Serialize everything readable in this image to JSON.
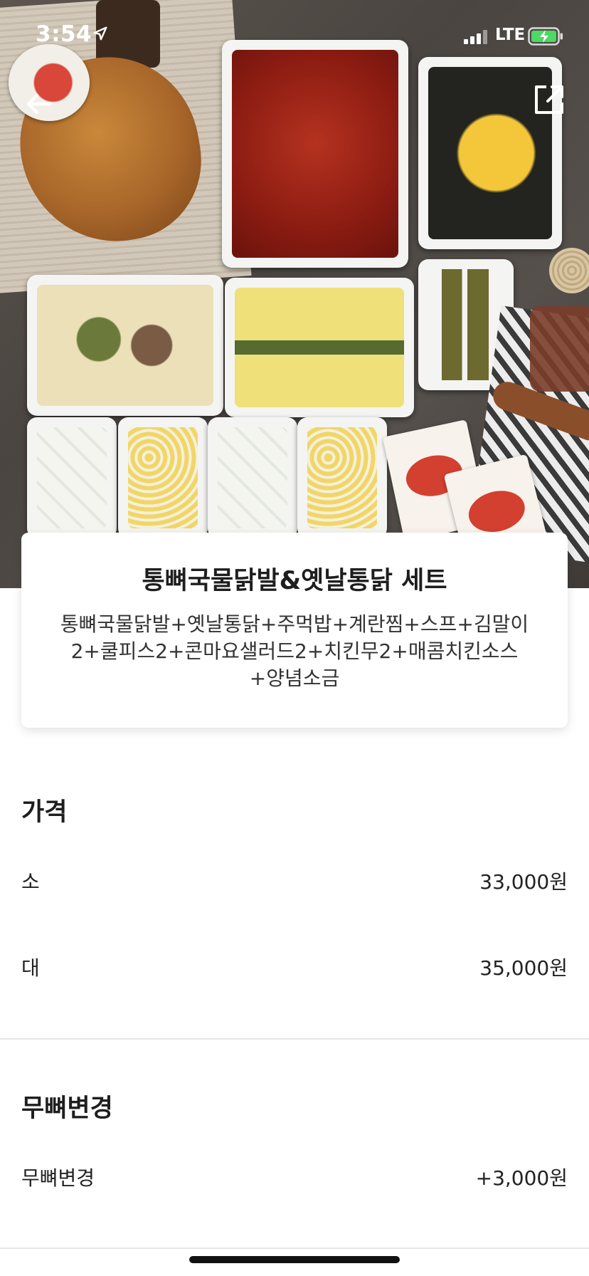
{
  "status_bar": {
    "time": "3:54",
    "network": "LTE",
    "icons": [
      "location-arrow-icon",
      "signal-icon",
      "battery-charging-icon"
    ]
  },
  "nav": {
    "back_icon": "arrow-left-icon",
    "share_icon": "external-share-icon"
  },
  "menu": {
    "title": "통뼈국물닭발&옛날통닭 세트",
    "description_lines": [
      "통뼈국물닭발+옛날통닭+주먹밥+계란찜+스프+김말이",
      "2+쿨피스2+콘마요샐러드2+치킨무2+매콤치킨소스",
      "+양념소금"
    ]
  },
  "price_section": {
    "title": "가격",
    "options": [
      {
        "label": "소",
        "price": "33,000원"
      },
      {
        "label": "대",
        "price": "35,000원"
      }
    ]
  },
  "boneless_section": {
    "title": "무뼈변경",
    "options": [
      {
        "label": "무뼈변경",
        "price": "+3,000원"
      }
    ]
  },
  "colors": {
    "text_primary": "#1e1e1e",
    "divider": "#e6e6e6",
    "battery_green": "#4cd964"
  }
}
